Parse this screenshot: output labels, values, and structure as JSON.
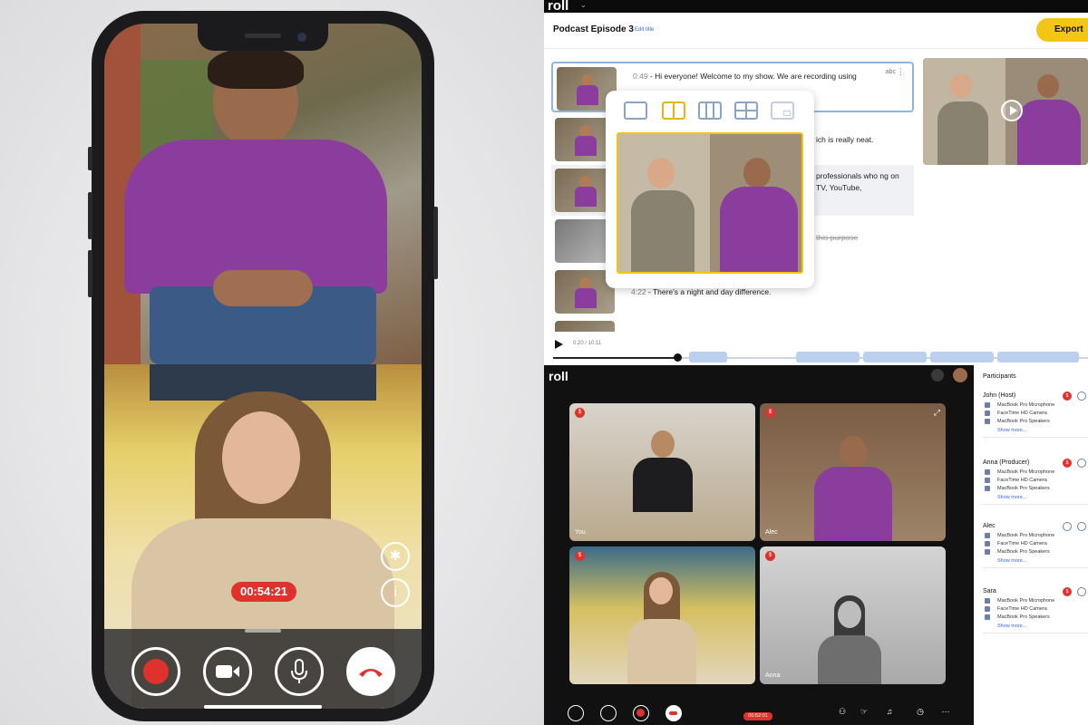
{
  "phone": {
    "call_timer": "00:54:21",
    "controls": [
      "record-button",
      "camera-button",
      "microphone-button",
      "end-call-button"
    ],
    "side_buttons": [
      "bluetooth",
      "info"
    ]
  },
  "editor": {
    "logo": "roll",
    "project_title": "Podcast Episode 3",
    "edit_title_label": "Edit title",
    "export_label": "Export",
    "rows": [
      {
        "time": "0:49",
        "text": "Hi everyone! Welcome to my show. We are recording using",
        "strike": false,
        "badge": "abc",
        "selected": true
      },
      {
        "time": "",
        "text": "ich is really neat.",
        "strike": false,
        "badge": "",
        "selected": false
      },
      {
        "time": "",
        "text": "professionals who ng on TV, YouTube,",
        "strike": false,
        "badge": "",
        "selected": false
      },
      {
        "time": "",
        "text": "this purpose",
        "strike": true,
        "badge": "",
        "selected": false
      },
      {
        "time": "4:22",
        "text": "There's a night and day difference.",
        "strike": false,
        "badge": "",
        "selected": false
      }
    ],
    "playback_time": "0:20 / 10:11"
  },
  "session": {
    "logo": "roll",
    "tiles": [
      {
        "label": "You"
      },
      {
        "label": "Alec"
      },
      {
        "label": ""
      },
      {
        "label": "Anna"
      }
    ],
    "timer": "00:52:01",
    "participants_title": "Participants",
    "participants": [
      {
        "name": "John (Host)",
        "devices": [
          "MacBook Pro Microphone",
          "FaceTime HD Camera",
          "MacBook Pro Speakers"
        ],
        "more": "Show more..."
      },
      {
        "name": "Anna (Producer)",
        "devices": [
          "MacBook Pro Microphone",
          "FaceTime HD Camera",
          "MacBook Pro Speakers"
        ],
        "more": "Show more..."
      },
      {
        "name": "Alec",
        "devices": [
          "MacBook Pro Microphone",
          "FaceTime HD Camera",
          "MacBook Pro Speakers"
        ],
        "more": "Show more..."
      },
      {
        "name": "Sara",
        "devices": [
          "MacBook Pro Microphone",
          "FaceTime HD Camera",
          "MacBook Pro Speakers"
        ],
        "more": "Show more..."
      }
    ],
    "toolbar": [
      "Invite",
      "Roles",
      "Sound board",
      "Time",
      "Options"
    ]
  },
  "colors": {
    "record_red": "#e0322c",
    "accent_yellow": "#f3c515",
    "shirt_purple": "#8a3d9c"
  }
}
